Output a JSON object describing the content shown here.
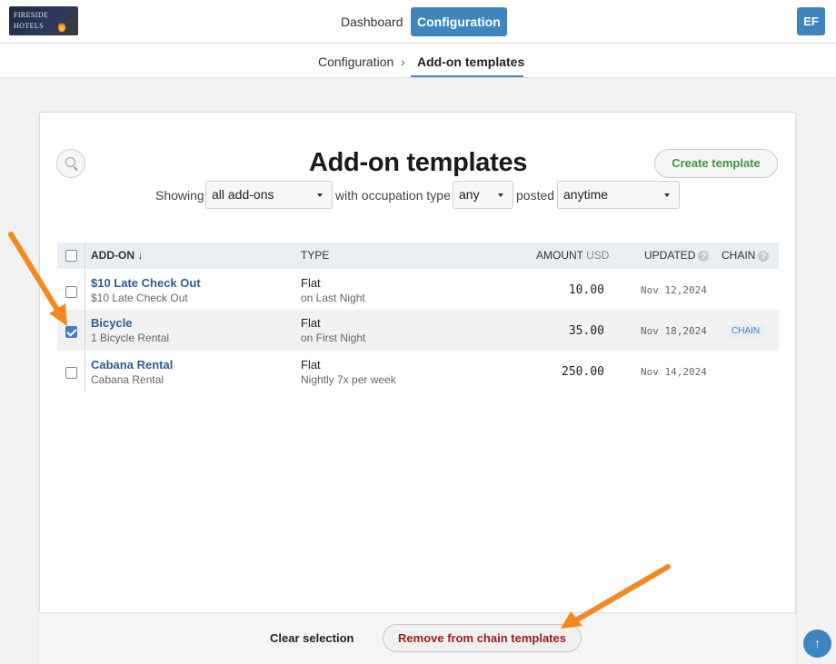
{
  "brand": {
    "line1": "FIRESIDE",
    "line2": "HOTELS"
  },
  "nav": {
    "dashboard": "Dashboard",
    "configuration": "Configuration",
    "avatar": "EF"
  },
  "breadcrumb": {
    "parent": "Configuration",
    "separator": "›",
    "current": "Add-on templates"
  },
  "page": {
    "title": "Add-on templates",
    "create_label": "Create template"
  },
  "filters": {
    "showing_label": "Showing",
    "showing_value": "all add-ons",
    "occupation_label": "with occupation type",
    "occupation_value": "any",
    "posted_label": "posted",
    "posted_value": "anytime"
  },
  "table": {
    "headers": {
      "addon": "ADD-ON ↓",
      "type": "TYPE",
      "amount": "AMOUNT",
      "amount_unit": "USD",
      "updated": "UPDATED",
      "chain": "CHAIN",
      "help": "?"
    },
    "rows": [
      {
        "name": "$10 Late Check Out",
        "desc": "$10 Late Check Out",
        "type": "Flat",
        "type_detail": "on Last Night",
        "amount": "10.00",
        "updated": "Nov 12,2024",
        "chain": "",
        "selected": false
      },
      {
        "name": "Bicycle",
        "desc": "1 Bicycle Rental",
        "type": "Flat",
        "type_detail": "on First Night",
        "amount": "35.00",
        "updated": "Nov 18,2024",
        "chain": "CHAIN",
        "selected": true
      },
      {
        "name": "Cabana Rental",
        "desc": "Cabana Rental",
        "type": "Flat",
        "type_detail": "Nightly 7x per week",
        "amount": "250.00",
        "updated": "Nov 14,2024",
        "chain": "",
        "selected": false
      }
    ]
  },
  "footer": {
    "clear_label": "Clear selection",
    "remove_label": "Remove from chain templates"
  },
  "scroll_top_icon": "↑",
  "colors": {
    "accent": "#3f86c1",
    "link": "#2f5c94",
    "create": "#3c9a3c",
    "danger": "#a11d1d",
    "annotation": "#f5891f"
  }
}
